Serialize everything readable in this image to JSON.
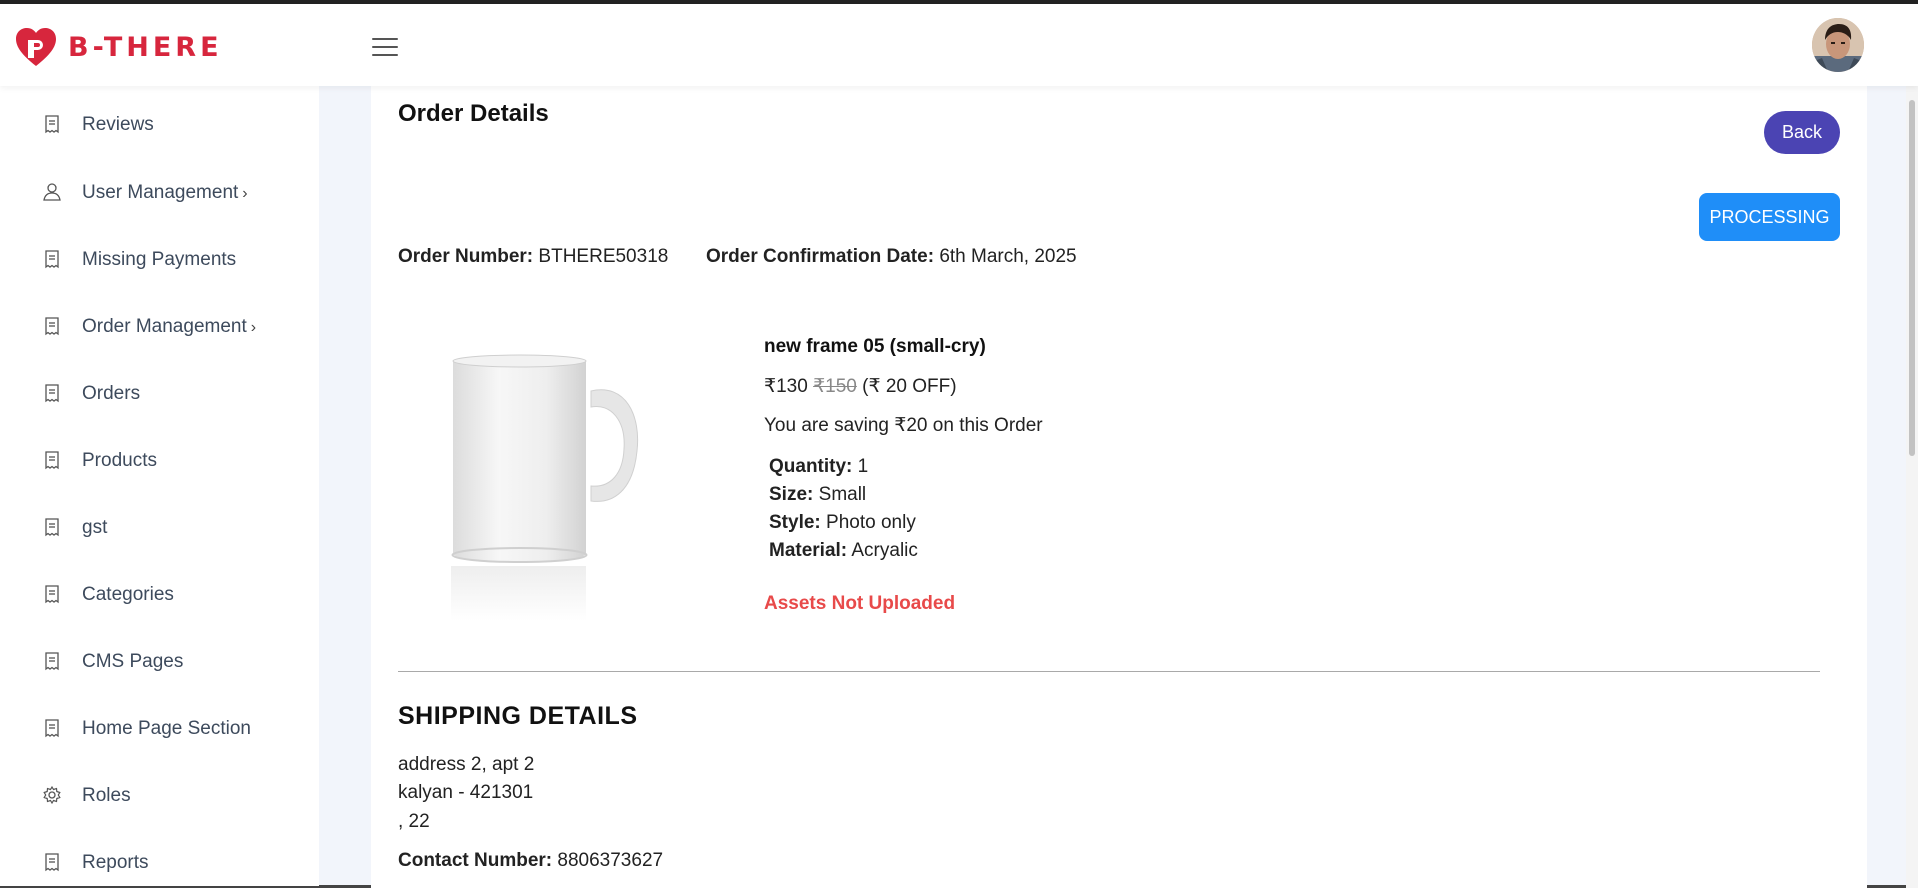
{
  "app": {
    "brand": "B-THERE",
    "brand_color": "#d7263d"
  },
  "sidebar": {
    "items": [
      {
        "label": "Reviews",
        "icon": "receipt-icon",
        "has_submenu": false
      },
      {
        "label": "User Management",
        "icon": "user-icon",
        "has_submenu": true
      },
      {
        "label": "Missing Payments",
        "icon": "receipt-icon",
        "has_submenu": false
      },
      {
        "label": "Order Management",
        "icon": "receipt-icon",
        "has_submenu": true
      },
      {
        "label": "Orders",
        "icon": "receipt-icon",
        "has_submenu": false
      },
      {
        "label": "Products",
        "icon": "receipt-icon",
        "has_submenu": false
      },
      {
        "label": "gst",
        "icon": "receipt-icon",
        "has_submenu": false
      },
      {
        "label": "Categories",
        "icon": "receipt-icon",
        "has_submenu": false
      },
      {
        "label": "CMS Pages",
        "icon": "receipt-icon",
        "has_submenu": false
      },
      {
        "label": "Home Page Section",
        "icon": "receipt-icon",
        "has_submenu": false
      },
      {
        "label": "Roles",
        "icon": "gear-icon",
        "has_submenu": false
      },
      {
        "label": "Reports",
        "icon": "receipt-icon",
        "has_submenu": false
      }
    ],
    "submenu_caret": "›"
  },
  "main": {
    "title": "Order Details",
    "back_label": "Back",
    "status_label": "PROCESSING",
    "status_color": "#1f8ef8",
    "order_number_label": "Order Number:",
    "order_number": "BTHERE50318",
    "confirmation_label": "Order Confirmation Date:",
    "confirmation_date": "6th March, 2025",
    "product": {
      "name": "new frame 05 (small-cry)",
      "price": "₹130",
      "original_price": "₹150",
      "discount": "(₹ 20 OFF)",
      "saving_text": "You are saving ₹20 on this Order",
      "attributes": [
        {
          "label": "Quantity:",
          "value": "1"
        },
        {
          "label": "Size:",
          "value": "Small"
        },
        {
          "label": "Style:",
          "value": "Photo only"
        },
        {
          "label": "Material:",
          "value": "Acryalic"
        }
      ],
      "assets_status": "Assets Not Uploaded",
      "image": "white-mug-image"
    },
    "shipping": {
      "title": "SHIPPING DETAILS",
      "address_lines": [
        "address 2, apt 2",
        "kalyan - 421301",
        ", 22"
      ],
      "contact_label": "Contact Number:",
      "contact_number": "8806373627"
    }
  }
}
